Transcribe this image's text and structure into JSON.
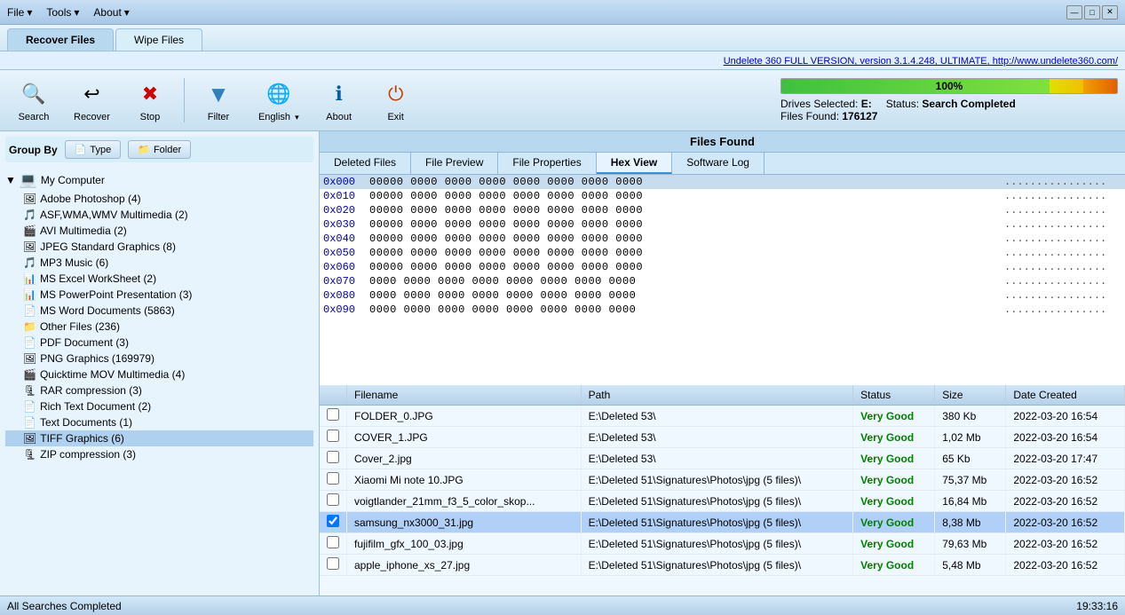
{
  "titlebar": {
    "menus": [
      {
        "label": "File",
        "hasArrow": true
      },
      {
        "label": "Tools",
        "hasArrow": true
      },
      {
        "label": "About",
        "hasArrow": true
      }
    ],
    "controls": [
      "—",
      "□",
      "✕"
    ]
  },
  "tabs": [
    {
      "label": "Recover Files",
      "active": true
    },
    {
      "label": "Wipe Files",
      "active": false
    }
  ],
  "linkbar": {
    "text": "Undelete 360 FULL VERSION, version 3.1.4.248, ULTIMATE, http://www.undelete360.com/"
  },
  "toolbar": {
    "buttons": [
      {
        "id": "search",
        "label": "Search",
        "icon": "🔍"
      },
      {
        "id": "recover",
        "label": "Recover",
        "icon": "↩"
      },
      {
        "id": "stop",
        "label": "Stop",
        "icon": "✖"
      },
      {
        "id": "filter",
        "label": "Filter",
        "icon": "▼",
        "hasArrow": false
      },
      {
        "id": "language",
        "label": "English",
        "icon": "🌐",
        "hasArrow": true
      },
      {
        "id": "about",
        "label": "About",
        "icon": "ℹ"
      },
      {
        "id": "exit",
        "label": "Exit",
        "icon": "⏻"
      }
    ]
  },
  "status": {
    "progress": 100,
    "drives_label": "Drives Selected:",
    "drives_value": "E:",
    "files_label": "Files Found:",
    "files_value": "176127",
    "status_label": "Status:",
    "status_value": "Search Completed"
  },
  "group_by": {
    "label": "Group By",
    "type_btn": "Type",
    "folder_btn": "Folder"
  },
  "sidebar": {
    "root": "My Computer",
    "items": [
      {
        "label": "Adobe Photoshop (4)",
        "icon": "🖼",
        "indent": 1
      },
      {
        "label": "ASF,WMA,WMV Multimedia (2)",
        "icon": "🎵",
        "indent": 1
      },
      {
        "label": "AVI Multimedia (2)",
        "icon": "🎬",
        "indent": 1
      },
      {
        "label": "JPEG Standard Graphics (8)",
        "icon": "🖼",
        "indent": 1
      },
      {
        "label": "MP3 Music (6)",
        "icon": "🎵",
        "indent": 1
      },
      {
        "label": "MS Excel WorkSheet (2)",
        "icon": "📊",
        "indent": 1
      },
      {
        "label": "MS PowerPoint Presentation (3)",
        "icon": "📊",
        "indent": 1
      },
      {
        "label": "MS Word Documents (5863)",
        "icon": "📄",
        "indent": 1
      },
      {
        "label": "Other Files (236)",
        "icon": "📁",
        "indent": 1
      },
      {
        "label": "PDF Document (3)",
        "icon": "📄",
        "indent": 1
      },
      {
        "label": "PNG Graphics (169979)",
        "icon": "🖼",
        "indent": 1
      },
      {
        "label": "Quicktime MOV Multimedia (4)",
        "icon": "🎬",
        "indent": 1
      },
      {
        "label": "RAR compression (3)",
        "icon": "🗜",
        "indent": 1
      },
      {
        "label": "Rich Text Document (2)",
        "icon": "📄",
        "indent": 1
      },
      {
        "label": "Text Documents (1)",
        "icon": "📄",
        "indent": 1
      },
      {
        "label": "TIFF Graphics (6)",
        "icon": "🖼",
        "indent": 1,
        "selected": true
      },
      {
        "label": "ZIP compression (3)",
        "icon": "🗜",
        "indent": 1
      }
    ]
  },
  "files_found": {
    "header": "Files Found",
    "tabs": [
      {
        "label": "Deleted Files"
      },
      {
        "label": "File Preview"
      },
      {
        "label": "File Properties"
      },
      {
        "label": "Hex View",
        "active": true
      },
      {
        "label": "Software Log"
      }
    ]
  },
  "hex_rows": [
    {
      "addr": "0x000",
      "bytes": "00000 0000 0000 0000 0000 0000 0000 0000",
      "ascii": "................"
    },
    {
      "addr": "0x010",
      "bytes": "00000 0000 0000 0000 0000 0000 0000 0000",
      "ascii": "................"
    },
    {
      "addr": "0x020",
      "bytes": "00000 0000 0000 0000 0000 0000 0000 0000",
      "ascii": "................"
    },
    {
      "addr": "0x030",
      "bytes": "00000 0000 0000 0000 0000 0000 0000 0000",
      "ascii": "................"
    },
    {
      "addr": "0x040",
      "bytes": "00000 0000 0000 0000 0000 0000 0000 0000",
      "ascii": "................"
    },
    {
      "addr": "0x050",
      "bytes": "00000 0000 0000 0000 0000 0000 0000 0000",
      "ascii": "................"
    },
    {
      "addr": "0x060",
      "bytes": "00000 0000 0000 0000 0000 0000 0000 0000",
      "ascii": "................"
    },
    {
      "addr": "0x070",
      "bytes": "0000 0000 0000 0000 0000 0000 0000 0000",
      "ascii": "................"
    },
    {
      "addr": "0x080",
      "bytes": "0000 0000 0000 0000 0000 0000 0000 0000",
      "ascii": "................"
    },
    {
      "addr": "0x090",
      "bytes": "0000 0000 0000 0000 0000 0000 0000 0000",
      "ascii": "................"
    }
  ],
  "table": {
    "columns": [
      "",
      "Filename",
      "Path",
      "Status",
      "Size",
      "Date Created"
    ],
    "rows": [
      {
        "checked": false,
        "filename": "FOLDER_0.JPG",
        "path": "E:\\Deleted 53\\",
        "status": "Very Good",
        "size": "380 Kb",
        "date": "2022-03-20 16:54",
        "selected": false
      },
      {
        "checked": false,
        "filename": "COVER_1.JPG",
        "path": "E:\\Deleted 53\\",
        "status": "Very Good",
        "size": "1,02 Mb",
        "date": "2022-03-20 16:54",
        "selected": false
      },
      {
        "checked": false,
        "filename": "Cover_2.jpg",
        "path": "E:\\Deleted 53\\",
        "status": "Very Good",
        "size": "65 Kb",
        "date": "2022-03-20 17:47",
        "selected": false
      },
      {
        "checked": false,
        "filename": "Xiaomi Mi note 10.JPG",
        "path": "E:\\Deleted 51\\Signatures\\Photos\\jpg (5 files)\\",
        "status": "Very Good",
        "size": "75,37 Mb",
        "date": "2022-03-20 16:52",
        "selected": false
      },
      {
        "checked": false,
        "filename": "voigtlander_21mm_f3_5_color_skop...",
        "path": "E:\\Deleted 51\\Signatures\\Photos\\jpg (5 files)\\",
        "status": "Very Good",
        "size": "16,84 Mb",
        "date": "2022-03-20 16:52",
        "selected": false
      },
      {
        "checked": true,
        "filename": "samsung_nx3000_31.jpg",
        "path": "E:\\Deleted 51\\Signatures\\Photos\\jpg (5 files)\\",
        "status": "Very Good",
        "size": "8,38 Mb",
        "date": "2022-03-20 16:52",
        "selected": true
      },
      {
        "checked": false,
        "filename": "fujifilm_gfx_100_03.jpg",
        "path": "E:\\Deleted 51\\Signatures\\Photos\\jpg (5 files)\\",
        "status": "Very Good",
        "size": "79,63 Mb",
        "date": "2022-03-20 16:52",
        "selected": false
      },
      {
        "checked": false,
        "filename": "apple_iphone_xs_27.jpg",
        "path": "E:\\Deleted 51\\Signatures\\Photos\\jpg (5 files)\\",
        "status": "Very Good",
        "size": "5,48 Mb",
        "date": "2022-03-20 16:52",
        "selected": false
      }
    ]
  },
  "statusbar": {
    "left": "All Searches Completed",
    "right": "19:33:16"
  }
}
